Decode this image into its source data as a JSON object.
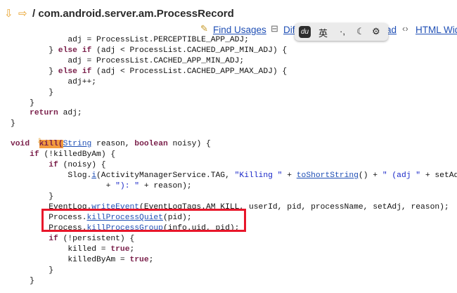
{
  "header": {
    "back_icon": "arrow-left-icon",
    "forward_icon": "arrow-right-icon",
    "breadcrumb": "/ com.android.server.am.ProcessRecord"
  },
  "toolbar": {
    "find_usages": "Find Usages",
    "diff_partial": "Dif",
    "download_partial": "ad",
    "html_view": "HTML Wid"
  },
  "ime_bar": {
    "logo": "du",
    "lang": "英",
    "punct": "·,",
    "moon_icon": "moon-icon",
    "settings_icon": "gear-icon"
  },
  "code": {
    "l1": "            adj = ProcessList.PERCEPTIBLE_APP_ADJ;",
    "l2a": "        } ",
    "l2b": "else if",
    "l2c": " (adj < ProcessList.CACHED_APP_MIN_ADJ) {",
    "l3": "            adj = ProcessList.CACHED_APP_MIN_ADJ;",
    "l4a": "        } ",
    "l4b": "else if",
    "l4c": " (adj < ProcessList.CACHED_APP_MAX_ADJ) {",
    "l5": "            adj++;",
    "l6": "        }",
    "l7": "    }",
    "l8a": "    ",
    "l8b": "return",
    "l8c": " adj;",
    "l9": "}",
    "l10a": "void",
    "l10b": "  ",
    "l10c": "kill(",
    "l10d": "String",
    "l10e": " reason, ",
    "l10f": "boolean",
    "l10g": " noisy) {",
    "l11a": "    ",
    "l11b": "if",
    "l11c": " (!killedByAm) {",
    "l12a": "        ",
    "l12b": "if",
    "l12c": " (noisy) {",
    "l13a": "            Slog.",
    "l13b": "i",
    "l13c": "(ActivityManagerService.TAG, ",
    "l13d": "\"Killing \"",
    "l13e": " + ",
    "l13f": "toShortString",
    "l13g": "() + ",
    "l13h": "\" (adj \"",
    "l13i": " + setAdj",
    "l14a": "                    + ",
    "l14b": "\"): \"",
    "l14c": " + reason);",
    "l15": "        }",
    "l16a": "        EventLog.",
    "l16b": "writeEvent",
    "l16c": "(EventLogTags.AM_KILL, userId, pid, processName, setAdj, reason);",
    "l17a": "        Process.",
    "l17b": "killProcessQuiet",
    "l17c": "(pid);",
    "l18a": "        Process.",
    "l18b": "killProcessGroup",
    "l18c": "(info.uid, pid);",
    "l19a": "        ",
    "l19b": "if",
    "l19c": " (!persistent) {",
    "l20a": "            killed = ",
    "l20b": "true",
    "l20c": ";",
    "l21a": "            killedByAm = ",
    "l21b": "true",
    "l21c": ";",
    "l22": "        }",
    "l23": "    }"
  }
}
